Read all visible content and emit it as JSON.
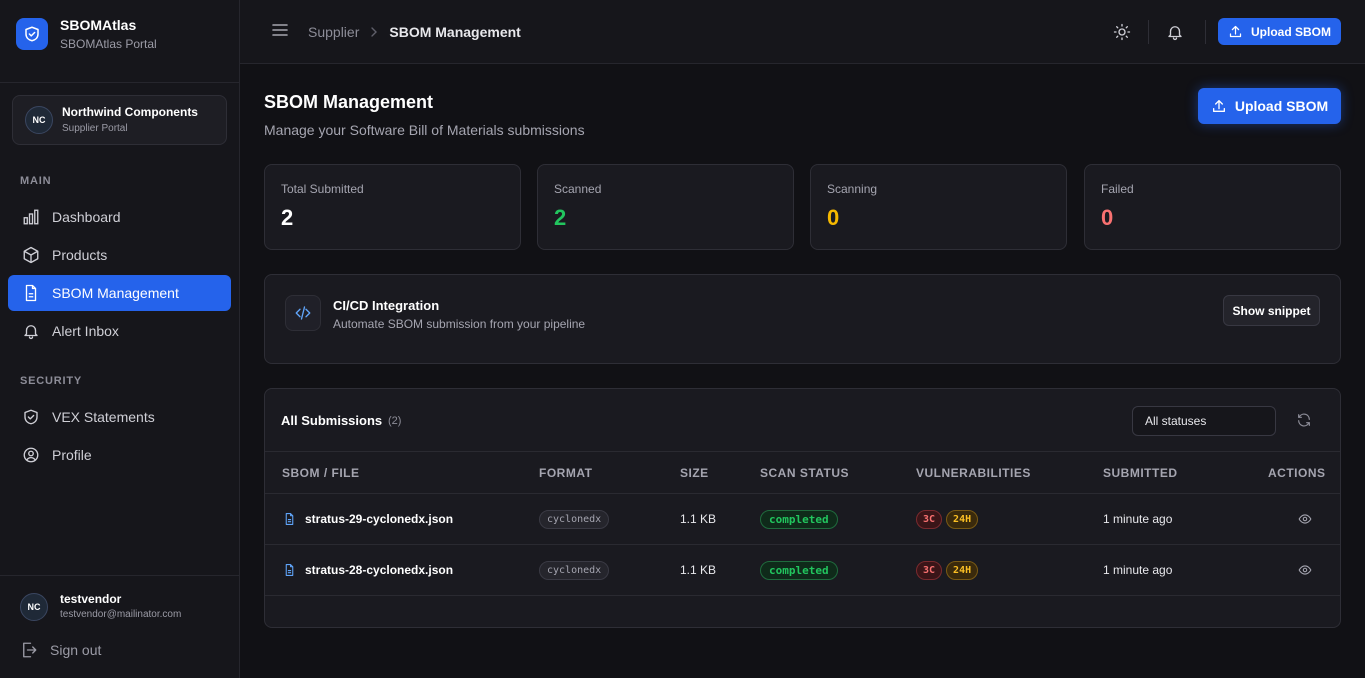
{
  "brand": {
    "name": "SBOMAtlas",
    "subtitle": "SBOMAtlas Portal"
  },
  "org": {
    "initials": "NC",
    "name": "Northwind Components",
    "role": "Supplier Portal"
  },
  "nav": {
    "main_heading": "MAIN",
    "main_items": [
      {
        "label": "Dashboard",
        "icon": "bar-chart-icon"
      },
      {
        "label": "Products",
        "icon": "box-icon"
      },
      {
        "label": "SBOM Management",
        "icon": "file-icon",
        "active": true
      },
      {
        "label": "Alert Inbox",
        "icon": "bell-icon"
      }
    ],
    "security_heading": "SECURITY",
    "security_items": [
      {
        "label": "VEX Statements",
        "icon": "shield-check-icon"
      },
      {
        "label": "Profile",
        "icon": "user-circle-icon"
      }
    ]
  },
  "user": {
    "initials": "NC",
    "name": "testvendor",
    "email": "testvendor@mailinator.com",
    "signout_label": "Sign out"
  },
  "topbar": {
    "breadcrumb_parent": "Supplier",
    "breadcrumb_current": "SBOM Management",
    "upload_label": "Upload SBOM"
  },
  "page": {
    "title": "SBOM Management",
    "subtitle": "Manage your Software Bill of Materials submissions",
    "upload_label": "Upload SBOM"
  },
  "stats": [
    {
      "label": "Total Submitted",
      "value": "2",
      "color": "#ffffff"
    },
    {
      "label": "Scanned",
      "value": "2",
      "color": "#22c55e"
    },
    {
      "label": "Scanning",
      "value": "0",
      "color": "#f5b800"
    },
    {
      "label": "Failed",
      "value": "0",
      "color": "#f87171"
    }
  ],
  "ci": {
    "title": "CI/CD Integration",
    "subtitle": "Automate SBOM submission from your pipeline",
    "button_label": "Show snippet"
  },
  "submissions": {
    "title": "All Submissions",
    "count": "(2)",
    "filter_value": "All statuses",
    "columns": [
      "SBOM / FILE",
      "FORMAT",
      "SIZE",
      "SCAN STATUS",
      "VULNERABILITIES",
      "SUBMITTED",
      "ACTIONS"
    ],
    "rows": [
      {
        "file": "stratus-29-cyclonedx.json",
        "format": "cyclonedx",
        "size": "1.1 KB",
        "status": "completed",
        "vuln_critical": "3C",
        "vuln_window": "24H",
        "submitted": "1 minute ago"
      },
      {
        "file": "stratus-28-cyclonedx.json",
        "format": "cyclonedx",
        "size": "1.1 KB",
        "status": "completed",
        "vuln_critical": "3C",
        "vuln_window": "24H",
        "submitted": "1 minute ago"
      }
    ]
  },
  "colors": {
    "accent": "#2563eb",
    "background": "#111115",
    "sidebar": "#16161b",
    "card": "#1a1a20",
    "success": "#22c55e",
    "warning": "#f5b800",
    "danger": "#f87171"
  }
}
